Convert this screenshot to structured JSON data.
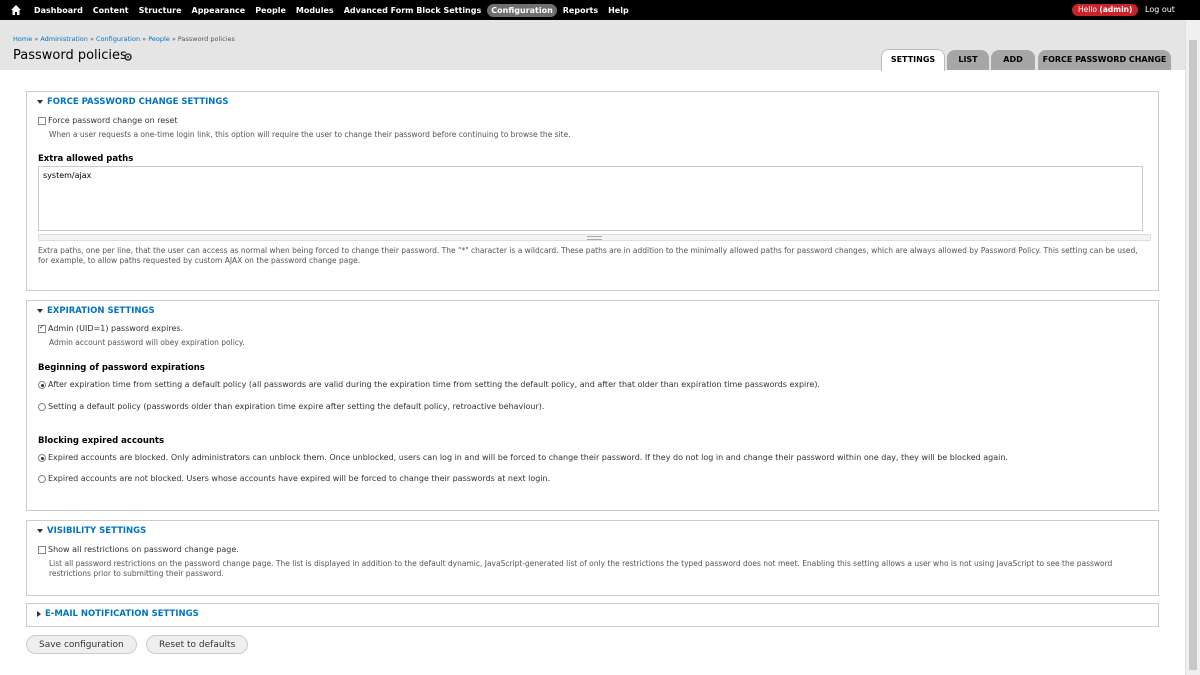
{
  "toolbar": {
    "items": [
      "Dashboard",
      "Content",
      "Structure",
      "Appearance",
      "People",
      "Modules",
      "Advanced Form Block Settings",
      "Configuration",
      "Reports",
      "Help"
    ],
    "hello_prefix": "Hello ",
    "user": "(admin)",
    "logout": "Log out"
  },
  "breadcrumb": {
    "home": "Home",
    "admin": "Administration",
    "config": "Configuration",
    "people": "People",
    "current": "Password policies",
    "sep": " » "
  },
  "page_title": "Password policies",
  "tabs": [
    "SETTINGS",
    "LIST",
    "ADD",
    "FORCE PASSWORD CHANGE"
  ],
  "force": {
    "legend": "FORCE PASSWORD CHANGE SETTINGS",
    "checkbox_label": "Force password change on reset",
    "checkbox_desc": "When a user requests a one-time login link, this option will require the user to change their password before continuing to browse the site.",
    "extra_label": "Extra allowed paths",
    "extra_value": "system/ajax",
    "extra_desc": "Extra paths, one per line, that the user can access as normal when being forced to change their password. The \"*\" character is a wildcard. These paths are in addition to the minimally allowed paths for password changes, which are always allowed by Password Policy. This setting can be used, for example, to allow paths requested by custom AJAX on the password change page."
  },
  "expiration": {
    "legend": "EXPIRATION SETTINGS",
    "admin_label": "Admin (UID=1) password expires.",
    "admin_desc": "Admin account password will obey expiration policy.",
    "begin_label": "Beginning of password expirations",
    "begin_opt1": "After expiration time from setting a default policy (all passwords are valid during the expiration time from setting the default policy, and after that older than expiration time passwords expire).",
    "begin_opt2": "Setting a default policy (passwords older than expiration time expire after setting the default policy, retroactive behaviour).",
    "block_label": "Blocking expired accounts",
    "block_opt1": "Expired accounts are blocked. Only administrators can unblock them. Once unblocked, users can log in and will be forced to change their password. If they do not log in and change their password within one day, they will be blocked again.",
    "block_opt2": "Expired accounts are not blocked. Users whose accounts have expired will be forced to change their passwords at next login."
  },
  "visibility": {
    "legend": "VISIBILITY SETTINGS",
    "checkbox_label": "Show all restrictions on password change page.",
    "checkbox_desc": "List all password restrictions on the password change page. The list is displayed in addition to the default dynamic, JavaScript-generated list of only the restrictions the typed password does not meet. Enabling this setting allows a user who is not using JavaScript to see the password restrictions prior to submitting their password."
  },
  "email": {
    "legend": "E-MAIL NOTIFICATION SETTINGS"
  },
  "buttons": {
    "save": "Save configuration",
    "reset": "Reset to defaults"
  }
}
